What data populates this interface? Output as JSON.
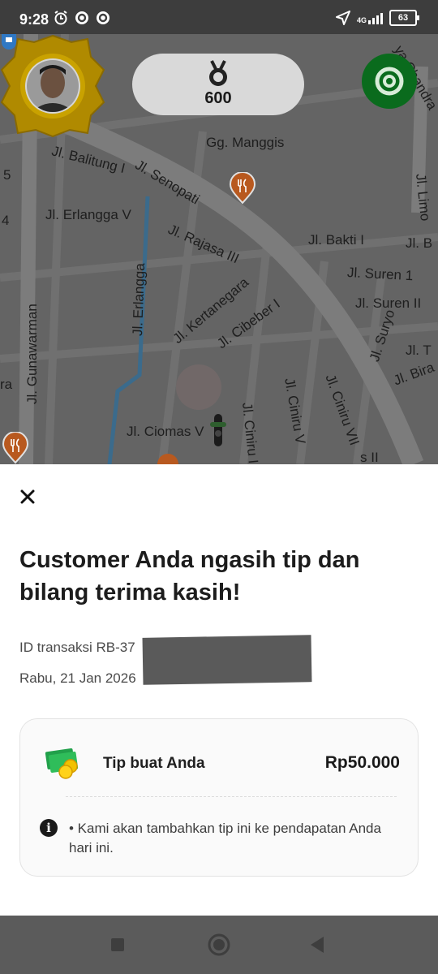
{
  "status_bar": {
    "time": "9:28",
    "network": "4G",
    "battery": "63"
  },
  "map": {
    "medal_points": "600",
    "streets": [
      {
        "label": "Gg. Manggis"
      },
      {
        "label": "Jl. Senopati"
      },
      {
        "label": "Jl. Balitung I"
      },
      {
        "label": "Jl. Erlangga V"
      },
      {
        "label": "Jl. Rajasa III"
      },
      {
        "label": "Jl. Bakti I"
      },
      {
        "label": "Jl. B"
      },
      {
        "label": "Jl. Suren 1"
      },
      {
        "label": "Jl. Suren II"
      },
      {
        "label": "Jl. Kertanegara"
      },
      {
        "label": "Jl. Cibeber I"
      },
      {
        "label": "Jl. Erlangga"
      },
      {
        "label": "Jl. Gunawarman"
      },
      {
        "label": "Jl. Ciomas V"
      },
      {
        "label": "Jl. Ciniru II"
      },
      {
        "label": "Jl. Ciniru V"
      },
      {
        "label": "Jl. Ciniru VII"
      },
      {
        "label": "Jl. Suryo"
      },
      {
        "label": "Jl. Limo"
      },
      {
        "label": "Jl. T"
      },
      {
        "label": "Jl. Bira"
      },
      {
        "label": "ya Chandra"
      },
      {
        "label": "5"
      },
      {
        "label": "4"
      },
      {
        "label": "ra"
      },
      {
        "label": "s II"
      }
    ]
  },
  "sheet": {
    "heading": "Customer Anda ngasih tip dan bilang terima kasih!",
    "transaction_id": "ID transaksi RB-37",
    "date": "Rabu, 21 Jan 2026",
    "card": {
      "tip_label": "Tip buat Anda",
      "tip_amount": "Rp50.000",
      "info_text": "• Kami akan tambahkan tip ini ke pendapatan Anda hari ini."
    }
  },
  "colors": {
    "brand_green": "#0a6b1d",
    "overlay_map": "#646464",
    "sheet_bg": "#ffffff"
  },
  "icons": [
    "alarm-icon",
    "location-arrow-icon",
    "medal-icon",
    "target-icon",
    "close-icon",
    "money-icon",
    "info-icon",
    "square-nav-icon",
    "circle-nav-icon",
    "back-nav-icon"
  ]
}
